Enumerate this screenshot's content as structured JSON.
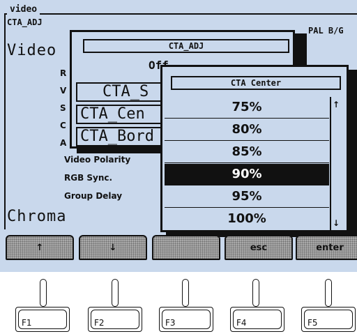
{
  "panel": {
    "group_title": "video",
    "cta_adj": "CTA_ADJ",
    "standard": "PAL B/G",
    "video_heading": "Video",
    "chroma_heading": "Chroma",
    "bg_rows": [
      {
        "text": "R"
      },
      {
        "text": "V"
      },
      {
        "text": "S"
      },
      {
        "text": "C"
      },
      {
        "text": "A"
      },
      {
        "text": "Video Polarity"
      },
      {
        "text": "RGB Sync."
      },
      {
        "text": "Group Delay"
      }
    ]
  },
  "popup_adj": {
    "title": "CTA_ADJ",
    "items": [
      "Off",
      "CTA_S",
      "CTA_Cen",
      "CTA_Bord"
    ]
  },
  "popup_center": {
    "title": "CTA Center",
    "options": [
      "75%",
      "80%",
      "85%",
      "90%",
      "95%",
      "100%"
    ],
    "selected": "90%",
    "scroll_up": "↑",
    "scroll_down": "↓"
  },
  "softkeys": [
    {
      "label": "↑",
      "icon": "arrow-up-icon"
    },
    {
      "label": "↓",
      "icon": "arrow-down-icon"
    },
    {
      "label": ""
    },
    {
      "label": "esc"
    },
    {
      "label": "enter"
    }
  ],
  "function_keys": [
    "F1",
    "F2",
    "F3",
    "F4",
    "F5"
  ],
  "colors": {
    "screen": "#c9d8ec",
    "ink": "#111111",
    "softkey": "#a9a9a9",
    "selected_bg": "#111111",
    "selected_fg": "#ffffff"
  }
}
